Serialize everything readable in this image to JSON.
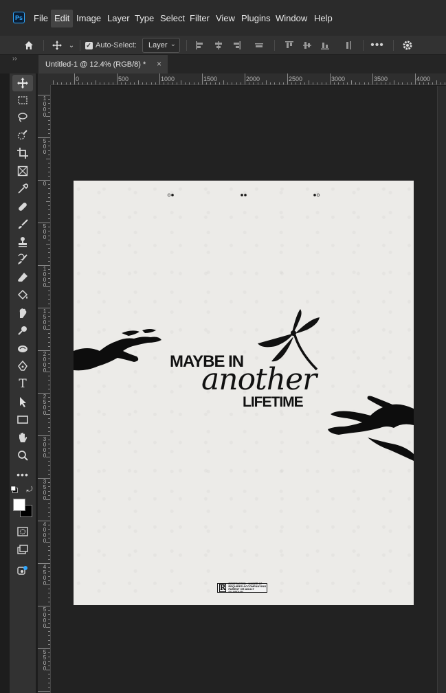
{
  "app": {
    "logo": "Ps",
    "menus": [
      "File",
      "Edit",
      "Image",
      "Layer",
      "Type",
      "Select",
      "Filter",
      "View",
      "Plugins",
      "Window",
      "Help"
    ],
    "active_menu": "Edit"
  },
  "options": {
    "auto_select_label": "Auto-Select:",
    "auto_select_checked": true,
    "layer_value": "Layer"
  },
  "document": {
    "tab_title": "Untitled-1 @ 12.4% (RGB/8) *",
    "close_glyph": "×"
  },
  "rulers": {
    "top_labels": [
      "0",
      "500",
      "1000",
      "1500",
      "2000",
      "2500",
      "3000",
      "3500",
      "4000"
    ],
    "left_labels": [
      "1000",
      "500",
      "0",
      "500",
      "1000",
      "1500",
      "2000",
      "2500",
      "3000",
      "3500",
      "4000",
      "4500",
      "5000",
      "5500"
    ]
  },
  "poster": {
    "line1": "MAYBE IN",
    "line2": "another",
    "line3": "LIFETIME",
    "rating_letter": "R",
    "rating_text": "RESTRICTED · UNDER 17 REQUIRES ACCOMPANYING PARENT OR ADULT GUARDIAN"
  },
  "tools": [
    "move-tool-icon",
    "marquee-tool-icon",
    "lasso-tool-icon",
    "quick-select-tool-icon",
    "crop-tool-icon",
    "frame-tool-icon",
    "eyedropper-tool-icon",
    "healing-brush-icon",
    "brush-tool-icon",
    "clone-stamp-icon",
    "history-brush-icon",
    "eraser-tool-icon",
    "paint-bucket-icon",
    "smudge-tool-icon",
    "dodge-tool-icon",
    "burn-tool-icon",
    "pen-tool-icon",
    "type-tool-icon",
    "path-select-icon",
    "rectangle-tool-icon",
    "hand-tool-icon",
    "zoom-tool-icon",
    "more-tools-icon",
    "default-colors-icon",
    "swap-colors-icon",
    "foreground-color-swatch",
    "quick-mask-icon",
    "screen-mode-icon",
    "generative-icon"
  ],
  "colors": {
    "accent": "#31a8ff",
    "foreground": "#ffffff",
    "background": "#000000",
    "canvas": "#ecebe8"
  }
}
